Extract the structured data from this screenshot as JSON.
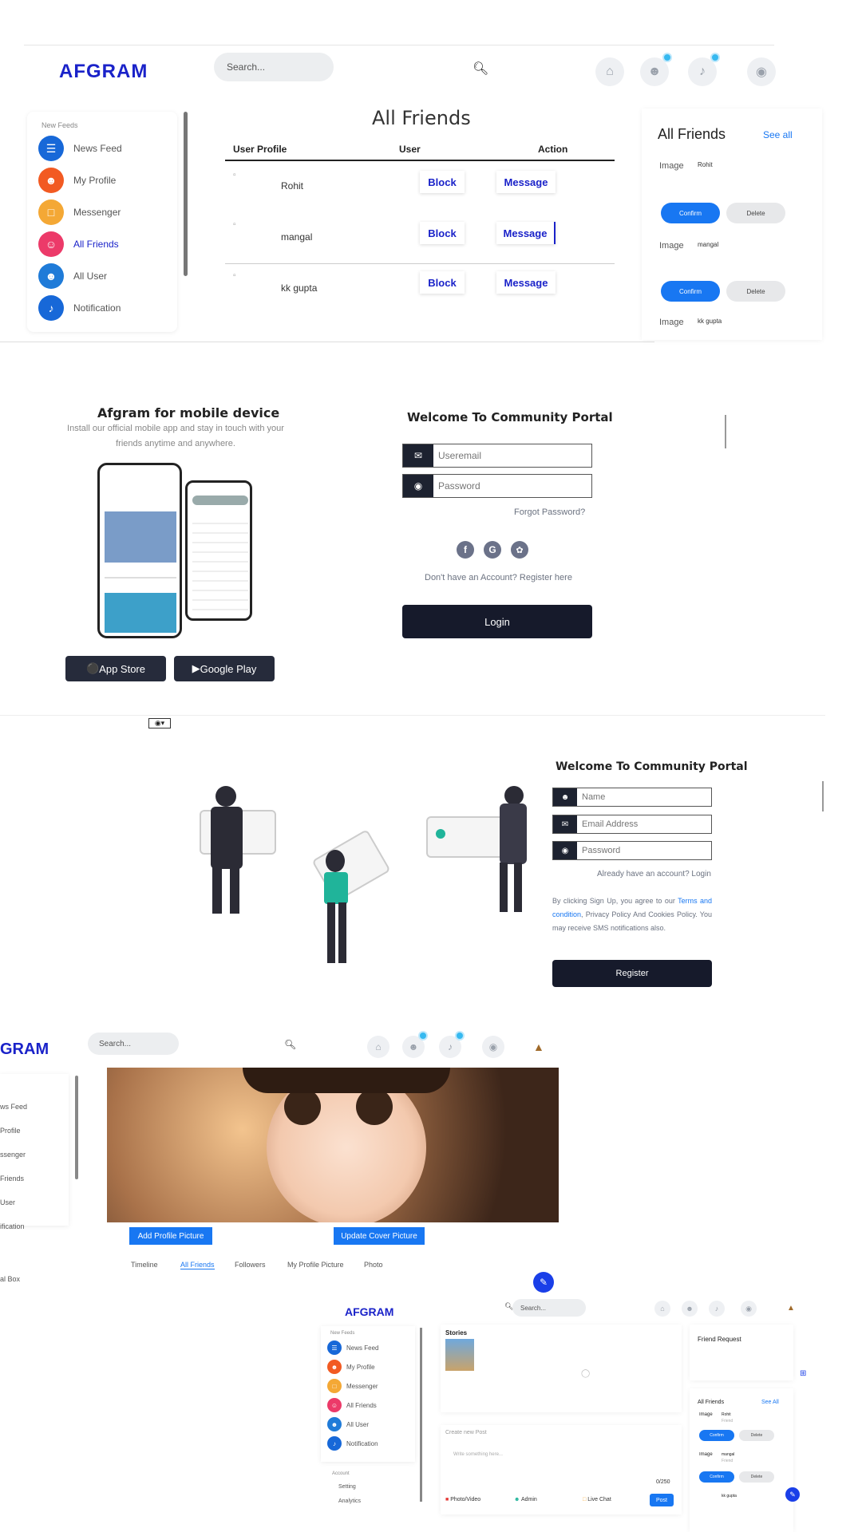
{
  "brand": {
    "logo": "AFGRAM",
    "logo_short": "GRAM"
  },
  "colors": {
    "brand_blue": "#1a22c9",
    "primary": "#1877f2",
    "dark": "#161a2b",
    "side_feed": "#1768d8",
    "side_profile": "#f25a22",
    "side_messenger": "#f4a835",
    "side_friends": "#ec3a69",
    "side_users": "#1f7bd8"
  },
  "header": {
    "search_placeholder": "Search...",
    "icons": [
      "home-icon",
      "user-icon",
      "bell-icon",
      "globe-icon"
    ]
  },
  "sidebar": {
    "section": "New Feeds",
    "items": [
      {
        "label": "News Feed",
        "icon": "newspaper-icon"
      },
      {
        "label": "My Profile",
        "icon": "user-icon"
      },
      {
        "label": "Messenger",
        "icon": "chat-icon"
      },
      {
        "label": "All Friends",
        "icon": "friends-icon"
      },
      {
        "label": "All User",
        "icon": "users-icon"
      },
      {
        "label": "Notification",
        "icon": "bell-icon"
      }
    ]
  },
  "friends_page": {
    "title": "All Friends",
    "columns": [
      "User Profile",
      "User",
      "Action"
    ],
    "rows": [
      {
        "name": "Rohit",
        "block": "Block",
        "message": "Message"
      },
      {
        "name": "mangal",
        "block": "Block",
        "message": "Message"
      },
      {
        "name": "kk gupta",
        "block": "Block",
        "message": "Message"
      }
    ],
    "right_panel": {
      "title": "All Friends",
      "see_all": "See all",
      "img_alt": "Image",
      "items": [
        {
          "name": "Rohit"
        },
        {
          "name": "mangal"
        },
        {
          "name": "kk gupta"
        }
      ],
      "confirm": "Confirm",
      "delete": "Delete"
    }
  },
  "login_page": {
    "mobile_title": "Afgram for mobile device",
    "mobile_text": "Install our official mobile app and stay in touch with your friends anytime and anywhere.",
    "app_store": "App Store",
    "google_play": "Google Play",
    "title": "Welcome To Community Portal",
    "email_placeholder": "Useremail",
    "password_placeholder": "Password",
    "forgot": "Forgot Password?",
    "register_link": "Don't have an Account? Register here",
    "login_btn": "Login",
    "socials": [
      "facebook-icon",
      "google-icon",
      "twitter-icon"
    ]
  },
  "register_page": {
    "title": "Welcome To Community Portal",
    "name_placeholder": "Name",
    "email_placeholder": "Email Address",
    "password_placeholder": "Password",
    "login_link": "Already have an account? Login",
    "terms_pre": "By clicking Sign Up, you agree to our",
    "terms_link": "Terms and condition",
    "terms_post": ", Privacy Policy And Cookies Policy. You may receive SMS notifications also.",
    "register_btn": "Register"
  },
  "profile_page": {
    "sidebar_items": [
      "ws Feed",
      "Profile",
      "ssenger",
      "Friends",
      "User",
      "ification",
      "al Box"
    ],
    "add_profile_btn": "Add Profile Picture",
    "update_cover_btn": "Update Cover Picture",
    "tabs": [
      "Timeline",
      "All Friends",
      "Followers",
      "My Profile Picture",
      "Photo"
    ]
  },
  "feed_page": {
    "stories": "Stories",
    "friend_request": "Friend Request",
    "all_friends": "All Friends",
    "see_all": "See All",
    "create_post": "Create new Post",
    "post_placeholder": "Write something here...",
    "counter": "0/250",
    "actions": [
      "Photo/Video",
      "Admin",
      "Live Chat"
    ],
    "post_btn": "Post",
    "friend_status": "Friend",
    "section2": "Account",
    "setting": "Setting",
    "analytics": "Analytics"
  }
}
